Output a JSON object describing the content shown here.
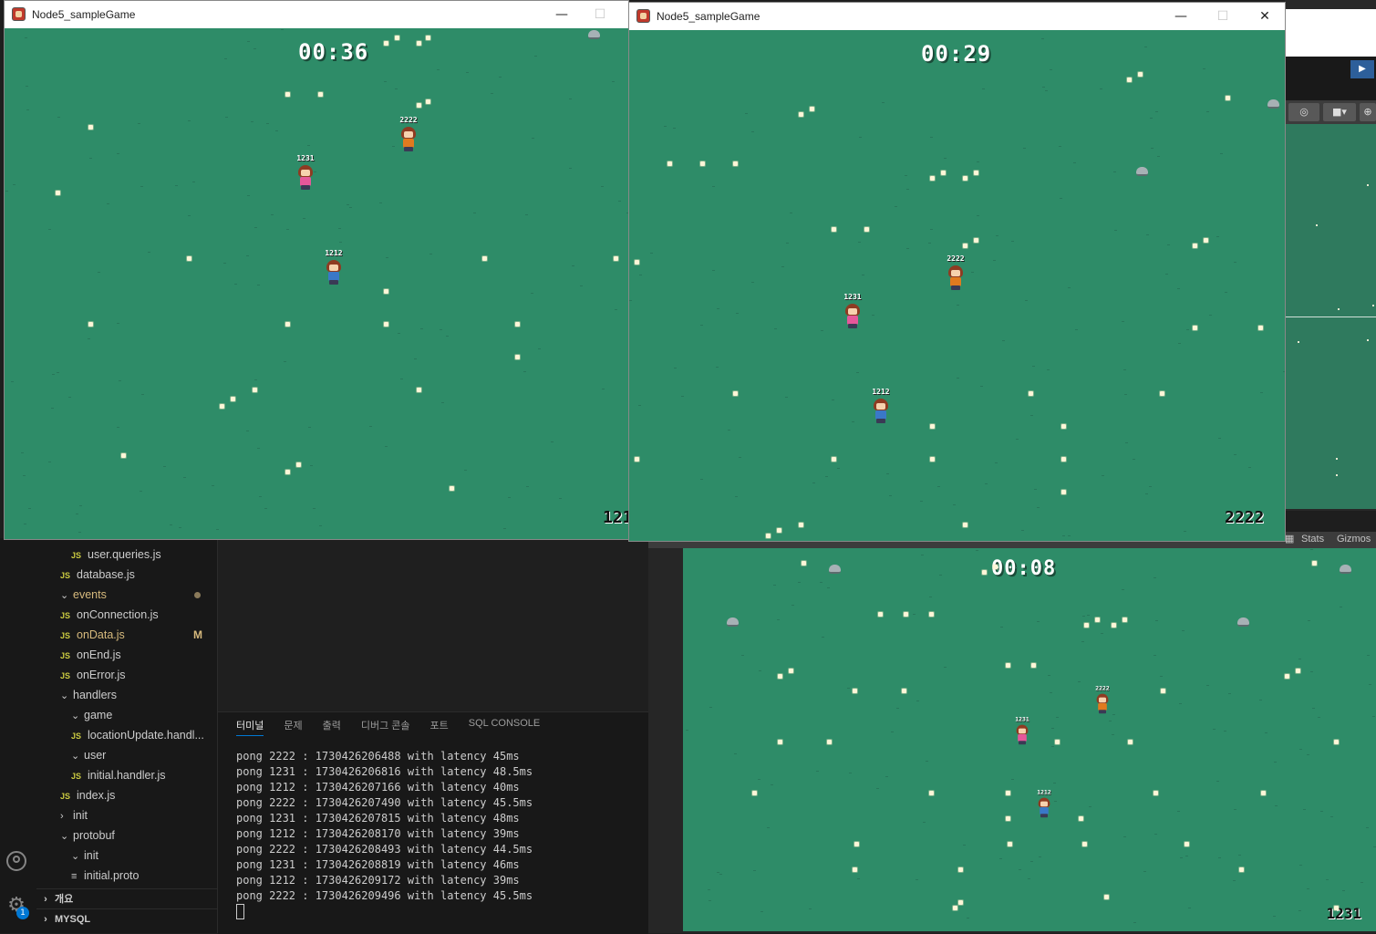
{
  "vscode": {
    "explorer": {
      "items": [
        {
          "label": "user.queries.js",
          "type": "js",
          "indent": 2
        },
        {
          "label": "database.js",
          "type": "js",
          "indent": 1
        },
        {
          "label": "events",
          "type": "folder-open",
          "indent": 1
        },
        {
          "label": "onConnection.js",
          "type": "js",
          "indent": 1
        },
        {
          "label": "onData.js",
          "type": "js",
          "indent": 1,
          "badge": "M"
        },
        {
          "label": "onEnd.js",
          "type": "js",
          "indent": 1
        },
        {
          "label": "onError.js",
          "type": "js",
          "indent": 1
        },
        {
          "label": "handlers",
          "type": "folder-open",
          "indent": 1
        },
        {
          "label": "game",
          "type": "folder-open",
          "indent": 2
        },
        {
          "label": "locationUpdate.handl...",
          "type": "js",
          "indent": 2
        },
        {
          "label": "user",
          "type": "folder-open",
          "indent": 2
        },
        {
          "label": "initial.handler.js",
          "type": "js",
          "indent": 2
        },
        {
          "label": "index.js",
          "type": "js",
          "indent": 1
        },
        {
          "label": "init",
          "type": "folder-closed",
          "indent": 1
        },
        {
          "label": "protobuf",
          "type": "folder-open",
          "indent": 1
        },
        {
          "label": "init",
          "type": "folder-open",
          "indent": 2
        },
        {
          "label": "initial.proto",
          "type": "file",
          "indent": 2
        }
      ],
      "sections": [
        "개요",
        "MYSQL"
      ]
    },
    "panel": {
      "tabs": [
        "터미널",
        "문제",
        "출력",
        "디버그 콘솔",
        "포트",
        "SQL CONSOLE"
      ],
      "terminal_lines": [
        "pong 2222 : 1730426206488 with latency 45ms",
        "pong 1231 : 1730426206816 with latency 48.5ms",
        "pong 1212 : 1730426207166 with latency 40ms",
        "pong 2222 : 1730426207490 with latency 45.5ms",
        "pong 1231 : 1730426207815 with latency 48ms",
        "pong 1212 : 1730426208170 with latency 39ms",
        "pong 2222 : 1730426208493 with latency 44.5ms",
        "pong 1231 : 1730426208819 with latency 46ms",
        "pong 1212 : 1730426209172 with latency 39ms",
        "pong 2222 : 1730426209496 with latency 45.5ms"
      ]
    },
    "activity_badge": "1"
  },
  "unity": {
    "game_bar": {
      "stats": "Stats",
      "gizmos": "Gizmos"
    }
  },
  "windows": [
    {
      "title": "Node5_sampleGame",
      "timer": "00:36",
      "self_id": "121",
      "players": [
        {
          "name": "2222",
          "color": "#e07a1f"
        },
        {
          "name": "1231",
          "color": "#e6579a"
        },
        {
          "name": "1212",
          "color": "#3a78c8"
        }
      ]
    },
    {
      "title": "Node5_sampleGame",
      "timer": "00:29",
      "self_id": "2222",
      "players": [
        {
          "name": "2222",
          "color": "#e07a1f"
        },
        {
          "name": "1231",
          "color": "#e6579a"
        },
        {
          "name": "1212",
          "color": "#3a78c8"
        }
      ]
    }
  ],
  "unity_game": {
    "timer": "00:08",
    "self_id": "1231",
    "players": [
      {
        "name": "2222",
        "color": "#e07a1f"
      },
      {
        "name": "1231",
        "color": "#e6579a"
      },
      {
        "name": "1212",
        "color": "#3a78c8"
      }
    ]
  },
  "window_controls": {
    "minimize": "—",
    "maximize": "☐",
    "close": "✕"
  }
}
